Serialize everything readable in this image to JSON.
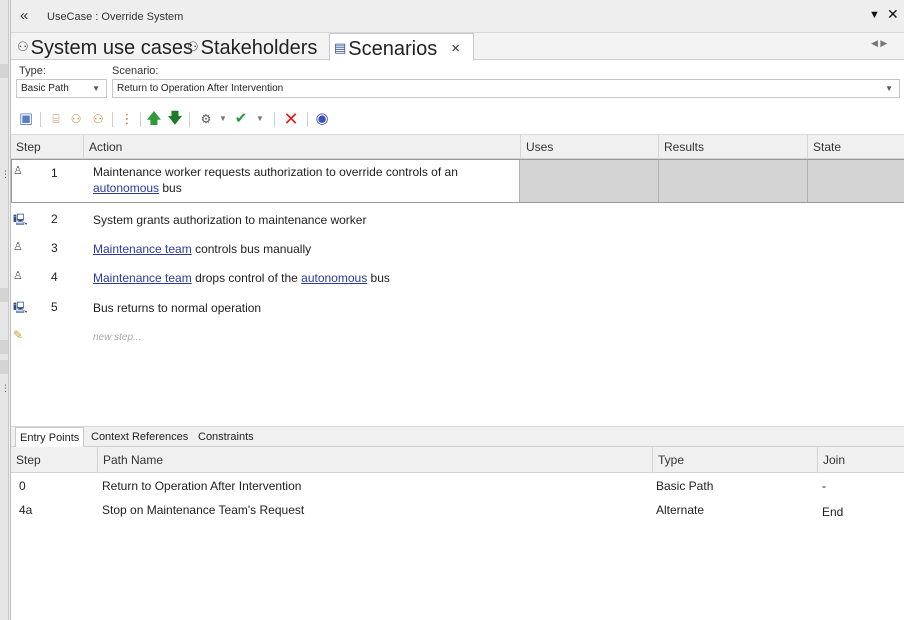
{
  "window": {
    "title": "UseCase : Override System",
    "collapse_icon": "double-chevron-left-icon",
    "dropdown_icon": "triangle-down-icon",
    "close_icon": "close-icon"
  },
  "tabs": [
    {
      "label": "System use cases",
      "icon": "stakeholder-icon"
    },
    {
      "label": "Stakeholders",
      "icon": "stakeholder-icon"
    },
    {
      "label": "Scenarios",
      "icon": "list-icon",
      "close": "×"
    }
  ],
  "form": {
    "type_label": "Type:",
    "scenario_label": "Scenario:",
    "type_value": "Basic Path",
    "scenario_value": "Return to Operation After Intervention"
  },
  "steps_table": {
    "columns": [
      "Step",
      "Action",
      "Uses",
      "Results",
      "State"
    ],
    "rows": [
      {
        "icon": "actor-icon",
        "step": "1",
        "action_pre": "Maintenance worker requests authorization to override controls of an",
        "link1": "autonomous",
        "action_post": " bus"
      },
      {
        "icon": "system-icon",
        "step": "2",
        "action": "System grants authorization to maintenance worker"
      },
      {
        "icon": "actor-icon",
        "step": "3",
        "link1": "Maintenance team",
        "action_post": " controls bus manually"
      },
      {
        "icon": "actor-icon",
        "step": "4",
        "link1": "Maintenance team",
        "action_mid": " drops control of the ",
        "link2": "autonomous",
        "action_post": " bus"
      },
      {
        "icon": "system-icon",
        "step": "5",
        "action": "Bus returns to normal operation"
      }
    ],
    "new_step_placeholder": "new step..."
  },
  "bottom_tabs": [
    "Entry Points",
    "Context References",
    "Constraints"
  ],
  "entry_table": {
    "columns": [
      "Step",
      "Path Name",
      "Type",
      "Join"
    ],
    "rows": [
      {
        "step": "0",
        "path": "Return to Operation After Intervention",
        "type": "Basic Path",
        "join": "-"
      },
      {
        "step": "4a",
        "path": "Stop on Maintenance Team's Request",
        "type": "Alternate",
        "join": "End"
      }
    ]
  },
  "colors": {
    "accent": "#2b3a9e",
    "selected_gray": "#d4d4d4",
    "delete_red": "#e02020",
    "arrow_green": "#2e9a3a"
  }
}
